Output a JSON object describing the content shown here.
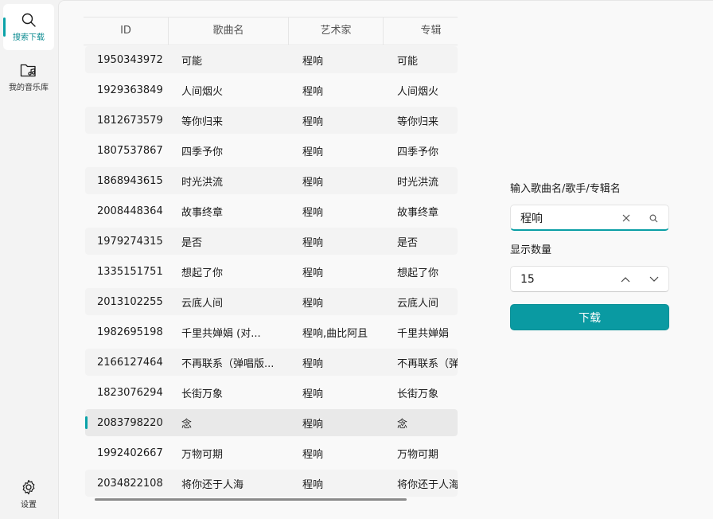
{
  "nav": {
    "search_label": "搜索下载",
    "library_label": "我的音乐库",
    "settings_label": "设置"
  },
  "table": {
    "headers": [
      "ID",
      "歌曲名",
      "艺术家",
      "专辑"
    ],
    "rows": [
      [
        "1950343972",
        "可能",
        "程响",
        "可能"
      ],
      [
        "1929363849",
        "人间烟火",
        "程响",
        "人间烟火"
      ],
      [
        "1812673579",
        "等你归来",
        "程响",
        "等你归来"
      ],
      [
        "1807537867",
        "四季予你",
        "程响",
        "四季予你"
      ],
      [
        "1868943615",
        "时光洪流",
        "程响",
        "时光洪流"
      ],
      [
        "2008448364",
        "故事终章",
        "程响",
        "故事终章"
      ],
      [
        "1979274315",
        "是否",
        "程响",
        "是否"
      ],
      [
        "1335151751",
        "想起了你",
        "程响",
        "想起了你"
      ],
      [
        "2013102255",
        "云底人间",
        "程响",
        "云底人间"
      ],
      [
        "1982695198",
        "千里共婵娟 (对...",
        "程响,曲比阿且",
        "千里共婵娟"
      ],
      [
        "2166127464",
        "不再联系（弹唱版...",
        "程响",
        "不再联系（弹"
      ],
      [
        "1823076294",
        "长街万象",
        "程响",
        "长街万象"
      ],
      [
        "2083798220",
        "念",
        "程响",
        "念"
      ],
      [
        "1992402667",
        "万物可期",
        "程响",
        "万物可期"
      ],
      [
        "2034822108",
        "将你还于人海",
        "程响",
        "将你还于人海"
      ]
    ],
    "selected_index": 12
  },
  "form": {
    "search_label": "输入歌曲名/歌手/专辑名",
    "search_value": "程响",
    "count_label": "显示数量",
    "count_value": "15",
    "download_label": "下载"
  },
  "colors": {
    "accent": "#0a9aa2",
    "background": "#f9f9f9"
  }
}
